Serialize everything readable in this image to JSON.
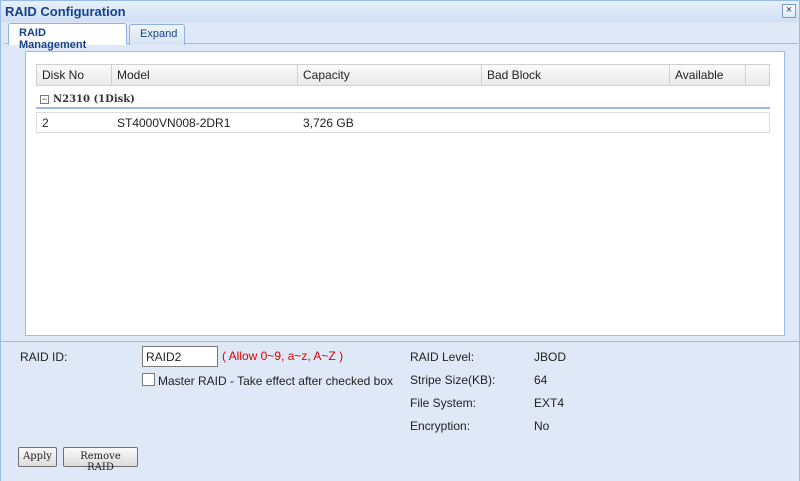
{
  "window": {
    "title": "RAID Configuration",
    "close_glyph": "×"
  },
  "tabs": [
    {
      "label": "RAID Management",
      "active": true
    },
    {
      "label": "Expand",
      "active": false
    }
  ],
  "grid": {
    "columns": [
      "Disk No",
      "Model",
      "Capacity",
      "Bad Block",
      "Available"
    ],
    "group": {
      "toggle": "−",
      "label": "N2310 (1Disk)"
    },
    "rows": [
      {
        "disk_no": "2",
        "model": "ST4000VN008-2DR1",
        "capacity": "3,726 GB",
        "bad_block": "",
        "available": ""
      }
    ]
  },
  "form": {
    "raid_id_label": "RAID ID:",
    "raid_id_value": "RAID2",
    "raid_id_hint": "( Allow 0~9, a~z, A~Z )",
    "master_raid_label": "Master RAID - Take effect after checked box",
    "master_raid_checked": false,
    "info": [
      {
        "label": "RAID Level:",
        "value": "JBOD"
      },
      {
        "label": "Stripe Size(KB):",
        "value": "64"
      },
      {
        "label": "File System:",
        "value": "EXT4"
      },
      {
        "label": "Encryption:",
        "value": "No"
      }
    ],
    "apply_label": "Apply",
    "remove_label": "Remove RAID"
  }
}
